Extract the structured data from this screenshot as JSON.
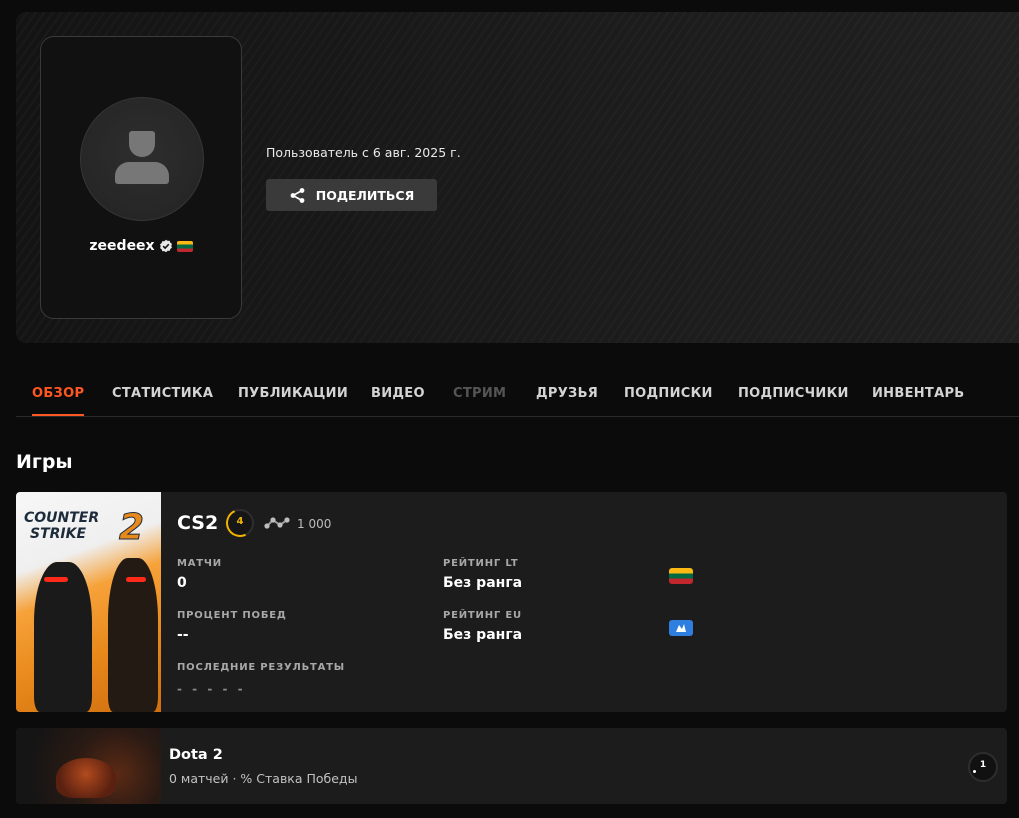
{
  "profile": {
    "username": "zeedeex",
    "member_since": "Пользователь с 6 авг. 2025 г.",
    "share_label": "ПОДЕЛИТЬСЯ"
  },
  "tabs": [
    {
      "label": "ОБЗОР",
      "state": "active"
    },
    {
      "label": "СТАТИСТИКА",
      "state": "normal"
    },
    {
      "label": "ПУБЛИКАЦИИ",
      "state": "normal"
    },
    {
      "label": "ВИДЕО",
      "state": "normal"
    },
    {
      "label": "СТРИМ",
      "state": "disabled"
    },
    {
      "label": "ДРУЗЬЯ",
      "state": "normal"
    },
    {
      "label": "ПОДПИСКИ",
      "state": "normal"
    },
    {
      "label": "ПОДПИСЧИКИ",
      "state": "normal"
    },
    {
      "label": "ИНВЕНТАРЬ",
      "state": "normal"
    }
  ],
  "games_section": {
    "title": "Игры"
  },
  "cs2": {
    "logo_line1": "COUNTER",
    "logo_line2": "STRIKE",
    "logo_number": "2",
    "name": "CS2",
    "level": "4",
    "elo": "1 000",
    "matches_label": "МАТЧИ",
    "matches_value": "0",
    "winrate_label": "ПРОЦЕНТ ПОБЕД",
    "winrate_value": "--",
    "recent_label": "ПОСЛЕДНИЕ РЕЗУЛЬТАТЫ",
    "recent_value": "- - - - -",
    "rating_lt_label": "РЕЙТИНГ LT",
    "rating_lt_value": "Без ранга",
    "rating_eu_label": "РЕЙТИНГ EU",
    "rating_eu_value": "Без ранга"
  },
  "dota": {
    "name": "Dota 2",
    "subtitle": "0 матчей · % Ставка Победы",
    "level": "1"
  },
  "colors": {
    "accent": "#ff5722",
    "level_yellow": "#f0b400",
    "card_bg": "#1c1c1c",
    "page_bg": "#0b0b0b"
  }
}
